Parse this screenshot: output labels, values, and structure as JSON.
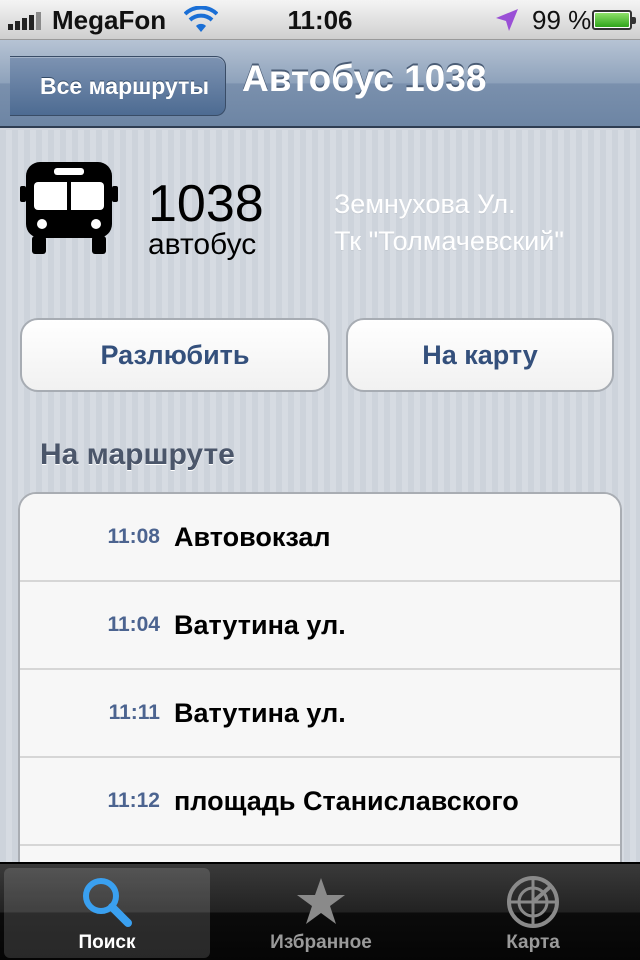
{
  "status_bar": {
    "carrier": "MegaFon",
    "time": "11:06",
    "battery_percent": "99 %",
    "battery_level": 0.99,
    "icons": [
      "signal-icon",
      "wifi-icon",
      "location-arrow-icon",
      "battery-icon"
    ]
  },
  "nav": {
    "back_label": "Все маршруты",
    "title": "Автобус 1038"
  },
  "route": {
    "number": "1038",
    "type": "автобус",
    "stop_from": "Земнухова Ул.",
    "stop_to": "Тк \"Толмачевский\"",
    "icon": "bus-icon"
  },
  "actions": {
    "unlike_label": "Разлюбить",
    "map_label": "На карту"
  },
  "section": {
    "title": "На маршруте"
  },
  "stops": [
    {
      "time": "11:08",
      "name": "Автовокзал"
    },
    {
      "time": "11:04",
      "name": "Ватутина ул."
    },
    {
      "time": "11:11",
      "name": "Ватутина ул."
    },
    {
      "time": "11:12",
      "name": "площадь Станиславского"
    }
  ],
  "tabs": [
    {
      "label": "Поиск",
      "icon": "search-icon",
      "active": true
    },
    {
      "label": "Избранное",
      "icon": "star-icon",
      "active": false
    },
    {
      "label": "Карта",
      "icon": "radar-icon",
      "active": false
    }
  ],
  "colors": {
    "nav_blue": "#7a90ad",
    "button_text": "#34507c",
    "time_text": "#4c6490",
    "location_arrow": "#9a4fd6",
    "battery_green": "#3fb82a"
  }
}
